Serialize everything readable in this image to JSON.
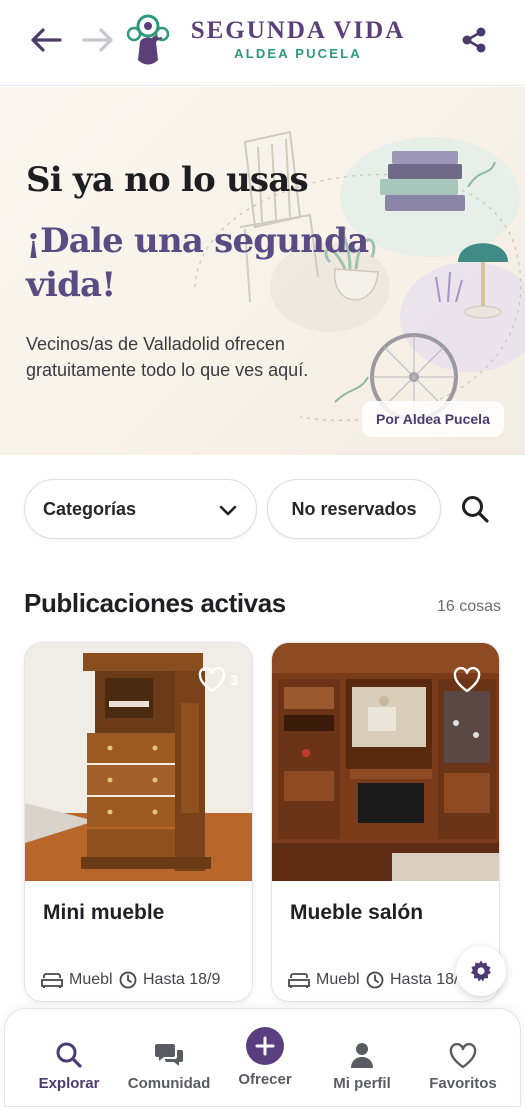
{
  "header": {
    "back_icon": "arrow-left-icon",
    "forward_icon": "arrow-right-icon",
    "logo_icon": "peacock-logo-icon",
    "brand_title": "SEGUNDA VIDA",
    "brand_subtitle": "ALDEA PUCELA",
    "share_icon": "share-icon"
  },
  "hero": {
    "headline": "Si ya no lo usas",
    "headline_accent": "¡Dale una segunda vida!",
    "description": "Vecinos/as de Valladolid ofrecen gratuitamente todo lo que ves aquí.",
    "badge": "Por Aldea Pucela"
  },
  "filters": {
    "categories_label": "Categorías",
    "reserved_label": "No reservados",
    "search_icon": "search-icon"
  },
  "listings": {
    "title": "Publicaciones activas",
    "count": "16 cosas",
    "items": [
      {
        "title": "Mini mueble",
        "likes": "3",
        "category": "Muebles",
        "deadline": "Hasta 18/9"
      },
      {
        "title": "Mueble salón",
        "likes": "",
        "category": "Muebles",
        "deadline": "Hasta 18/9"
      }
    ]
  },
  "bottom_nav": {
    "items": [
      {
        "label": "Explorar",
        "icon": "search-icon",
        "active": true
      },
      {
        "label": "Comunidad",
        "icon": "chat-bubbles-icon",
        "active": false
      },
      {
        "label": "Ofrecer",
        "icon": "plus-circle-icon",
        "active": false
      },
      {
        "label": "Mi perfil",
        "icon": "user-icon",
        "active": false
      },
      {
        "label": "Favoritos",
        "icon": "heart-icon",
        "active": false
      }
    ]
  },
  "colors": {
    "brand_purple": "#5a3f78",
    "brand_green": "#2e9a7b",
    "accent_purple": "#5c4a83",
    "hero_background": "#f7f1e7"
  }
}
